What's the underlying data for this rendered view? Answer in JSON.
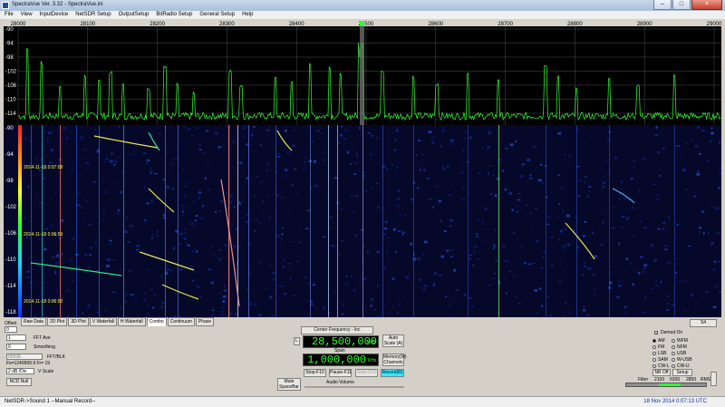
{
  "window": {
    "title": "SpectraVue Ver. 3.32 - SpectraVue.ini"
  },
  "menu": [
    "File",
    "View",
    "InputDevice",
    "NetSDR Setup",
    "OutputSetup",
    "BitRadio Setup",
    "General Setup",
    "Help"
  ],
  "spectrum": {
    "freq_labels": [
      "28000",
      "28100",
      "28200",
      "28300",
      "28400",
      "28500",
      "28600",
      "28700",
      "28800",
      "28900",
      "29000"
    ],
    "db_labels": [
      "-90",
      "-94",
      "-98",
      "-102",
      "-106",
      "-110",
      "-114"
    ],
    "trace_color": "#33ff33"
  },
  "waterfall": {
    "db_labels": [
      "-90",
      "-94",
      "-98",
      "-102",
      "-106",
      "-110",
      "-114",
      "-118"
    ],
    "timestamps": [
      "2014-11-18 0:07:08",
      "2014-11-18 0:06:59",
      "2014-11-18 0:06:50"
    ]
  },
  "tabs": [
    "Raw Data",
    "2D Plot",
    "3D Plot",
    "V Waterfall",
    "H Waterfall",
    "Combo",
    "Continuum",
    "Phase"
  ],
  "active_tab": "Combo",
  "left_controls": {
    "offset_label": "Offset",
    "offset_value": "0",
    "fft_ave_value": "1",
    "fft_ave_label": "FFT Ave",
    "smoothing_value": "0",
    "smoothing_label": "Smoothing",
    "fft_blk_value": "65536",
    "fft_blk_label": "FFT/BLK",
    "bin_info": "Fs=1249999.9 Fr= 19",
    "vscale_value": "2 dB /Div",
    "vscale_label": "V Scale",
    "ncd_null": "NCD Null"
  },
  "center_controls": {
    "center_freq_button": "Center Frequency - Inc",
    "l_button": "L",
    "center_freq_value": "28,500,000",
    "khz_unit": "KHz",
    "auto_scale": "Auto Scale (A)",
    "span_label": "Span",
    "span_value": "1,000,000",
    "span_unit": "KHz",
    "memory_channels": "Memory(M) Channels",
    "stop": "Stop-F10",
    "pause": "Pause-F11",
    "start": "Start-F12",
    "record": "Record(R)",
    "mute": "Mute SpaceBar",
    "audio_volume": "Audio Volume"
  },
  "right_controls": {
    "s4_label": "S4",
    "demod_on": "Demod On",
    "modes": [
      "AM",
      "WFM",
      "FM",
      "NFM",
      "LSB",
      "USB",
      "SAM",
      "W-USB",
      "CW-L",
      "CW-U"
    ],
    "selected_mode": "AM",
    "nb_off": "NB Off",
    "setup": "Setup",
    "filter_label": "Filter",
    "filter_values": [
      "2100",
      "6200",
      "2800"
    ],
    "rms": "RMS"
  },
  "status": {
    "left": "NetSDR->Sound 1  --Manual Record--",
    "right": "18 Nov 2014  0:07:13 UTC"
  }
}
